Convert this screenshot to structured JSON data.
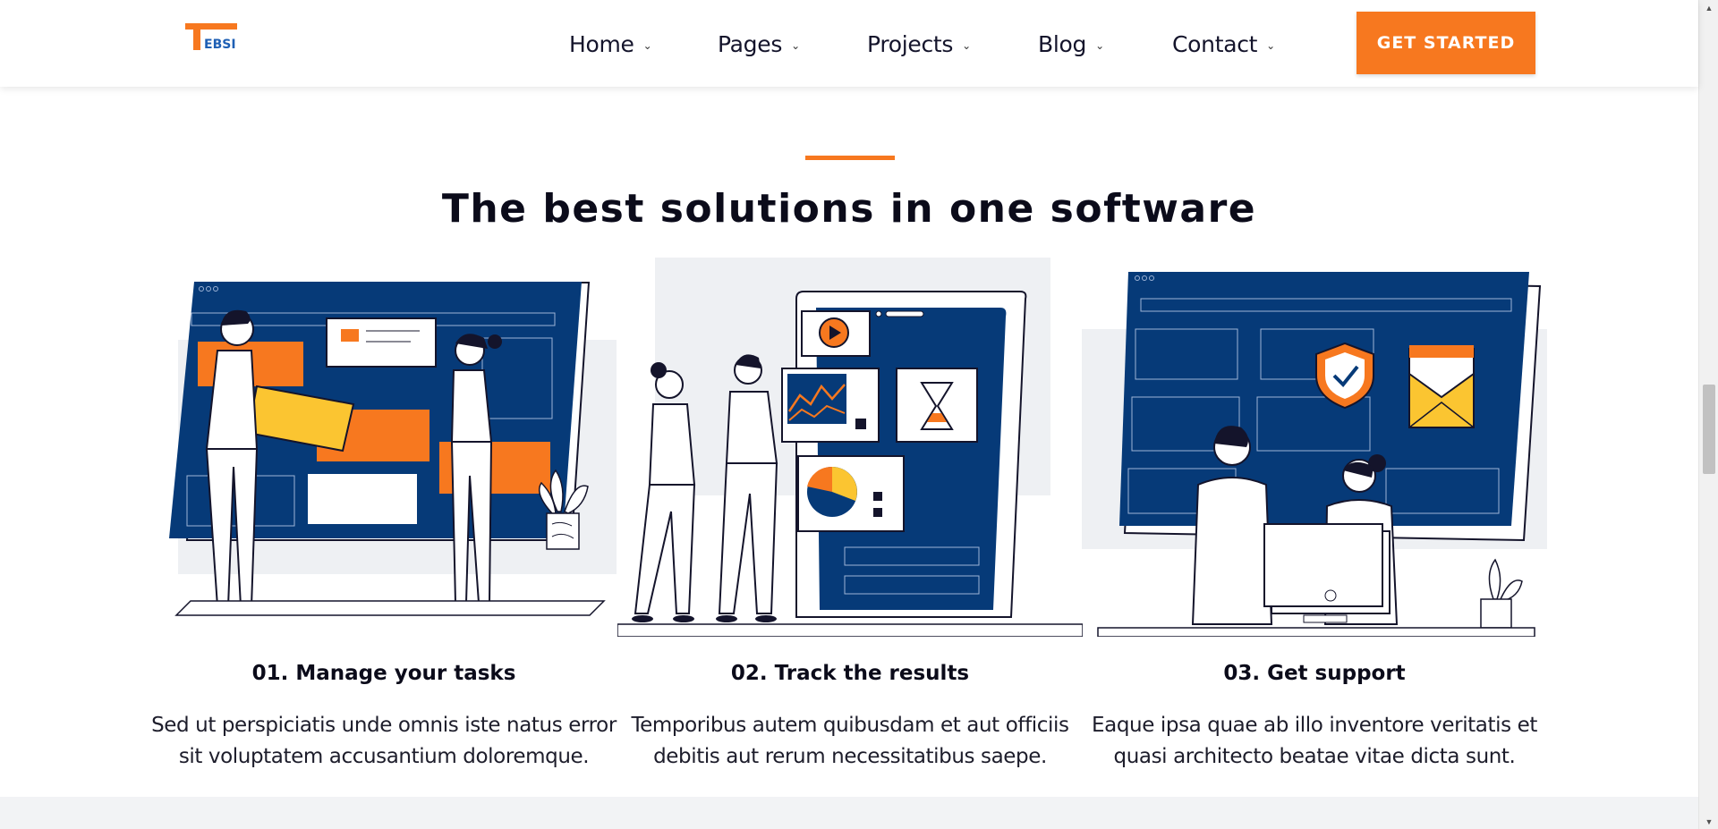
{
  "brand": {
    "logo_text": "EBSI",
    "logo_letter": "T",
    "accent": "#f7781f",
    "navy": "#063a78",
    "yellow": "#fbc531"
  },
  "nav": [
    {
      "label": "Home",
      "chevron": "chevron-down-icon"
    },
    {
      "label": "Pages",
      "chevron": "chevron-down-icon"
    },
    {
      "label": "Projects",
      "chevron": "chevron-down-icon"
    },
    {
      "label": "Blog",
      "chevron": "chevron-down-icon"
    },
    {
      "label": "Contact",
      "chevron": "chevron-down-icon"
    }
  ],
  "cta": {
    "label": "GET STARTED"
  },
  "section": {
    "title": "The best solutions in one software",
    "features": [
      {
        "title": "01. Manage your tasks",
        "text": "Sed ut perspiciatis unde omnis iste natus error sit voluptatem accusantium doloremque.",
        "illustration": "task-board-illustration"
      },
      {
        "title": "02. Track the results",
        "text": "Temporibus autem quibusdam et aut officiis debitis aut rerum necessitatibus saepe.",
        "illustration": "analytics-phone-illustration"
      },
      {
        "title": "03. Get support",
        "text": "Eaque ipsa quae ab illo inventore veritatis et quasi architecto beatae vitae dicta sunt.",
        "illustration": "support-screen-illustration"
      }
    ]
  }
}
